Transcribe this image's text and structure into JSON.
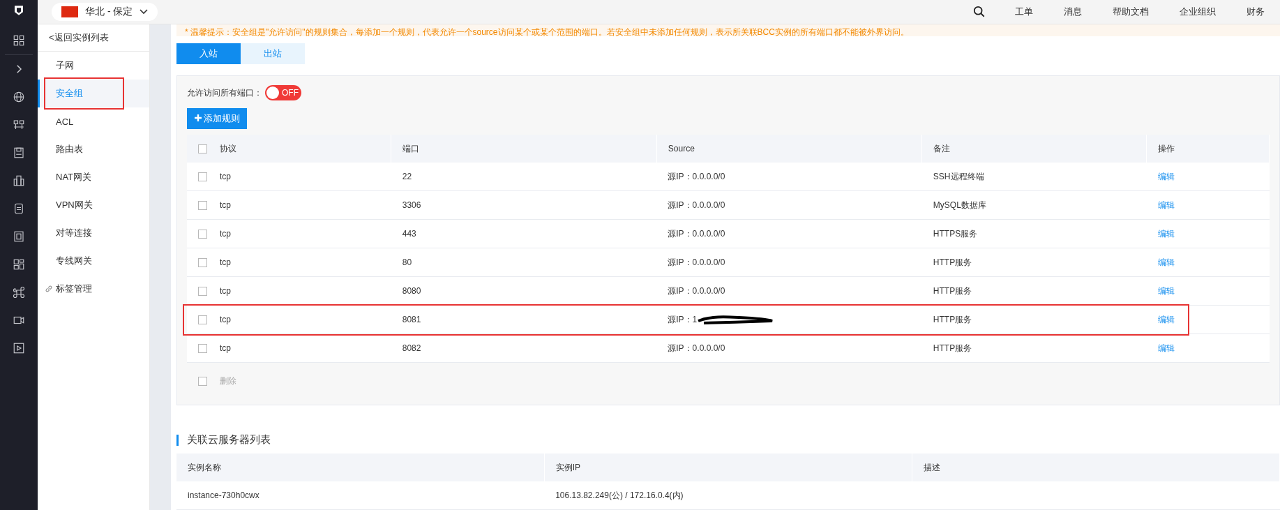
{
  "top_bar": {
    "region": "华北 - 保定",
    "nav": [
      "工单",
      "消息",
      "帮助文档",
      "企业组织",
      "财务"
    ]
  },
  "sidebar": {
    "back_link": "<返回实例列表",
    "items": [
      {
        "label": "子网",
        "selected": false,
        "highlighted": false
      },
      {
        "label": "安全组",
        "selected": true,
        "highlighted": true
      },
      {
        "label": "ACL",
        "selected": false,
        "highlighted": false
      },
      {
        "label": "路由表",
        "selected": false,
        "highlighted": false
      },
      {
        "label": "NAT网关",
        "selected": false,
        "highlighted": false
      },
      {
        "label": "VPN网关",
        "selected": false,
        "highlighted": false
      },
      {
        "label": "对等连接",
        "selected": false,
        "highlighted": false
      },
      {
        "label": "专线网关",
        "selected": false,
        "highlighted": false
      },
      {
        "label": "标签管理",
        "selected": false,
        "highlighted": false,
        "kind": "link"
      }
    ]
  },
  "notice": "* 温馨提示：安全组是\"允许访问\"的规则集合，每添加一个规则，代表允许一个source访问某个或某个范围的端口。若安全组中未添加任何规则，表示所关联BCC实例的所有端口都不能被外界访问。",
  "tabs": [
    {
      "label": "入站",
      "selected": true
    },
    {
      "label": "出站",
      "selected": false
    }
  ],
  "allow_all_ports": {
    "label": "允许访问所有端口：",
    "on": false,
    "text": "OFF"
  },
  "add_rule_button": "添加规则",
  "rules_table": {
    "select_all_checked": false,
    "columns": [
      "协议",
      "端口",
      "Source",
      "备注",
      "操作"
    ],
    "rows": [
      {
        "protocol": "tcp",
        "port": "22",
        "source": "源IP：0.0.0.0/0",
        "note": "SSH远程终端",
        "action": "编辑",
        "checked": false,
        "highlighted": false,
        "redacted": false
      },
      {
        "protocol": "tcp",
        "port": "3306",
        "source": "源IP：0.0.0.0/0",
        "note": "MySQL数据库",
        "action": "编辑",
        "checked": false,
        "highlighted": false,
        "redacted": false
      },
      {
        "protocol": "tcp",
        "port": "443",
        "source": "源IP：0.0.0.0/0",
        "note": "HTTPS服务",
        "action": "编辑",
        "checked": false,
        "highlighted": false,
        "redacted": false
      },
      {
        "protocol": "tcp",
        "port": "80",
        "source": "源IP：0.0.0.0/0",
        "note": "HTTP服务",
        "action": "编辑",
        "checked": false,
        "highlighted": false,
        "redacted": false
      },
      {
        "protocol": "tcp",
        "port": "8080",
        "source": "源IP：0.0.0.0/0",
        "note": "HTTP服务",
        "action": "编辑",
        "checked": false,
        "highlighted": false,
        "redacted": false
      },
      {
        "protocol": "tcp",
        "port": "8081",
        "source": "源IP：1",
        "note": "HTTP服务",
        "action": "编辑",
        "checked": false,
        "highlighted": true,
        "redacted": true
      },
      {
        "protocol": "tcp",
        "port": "8082",
        "source": "源IP：0.0.0.0/0",
        "note": "HTTP服务",
        "action": "编辑",
        "checked": false,
        "highlighted": false,
        "redacted": false
      }
    ],
    "delete_checked": false,
    "delete_button": "删除"
  },
  "servers_section": {
    "title": "关联云服务器列表",
    "columns": [
      "实例名称",
      "实例IP",
      "描述"
    ],
    "rows": [
      {
        "name": "instance-730h0cwx",
        "ip": "106.13.82.249(公) / 172.16.0.4(内)"
      }
    ]
  }
}
